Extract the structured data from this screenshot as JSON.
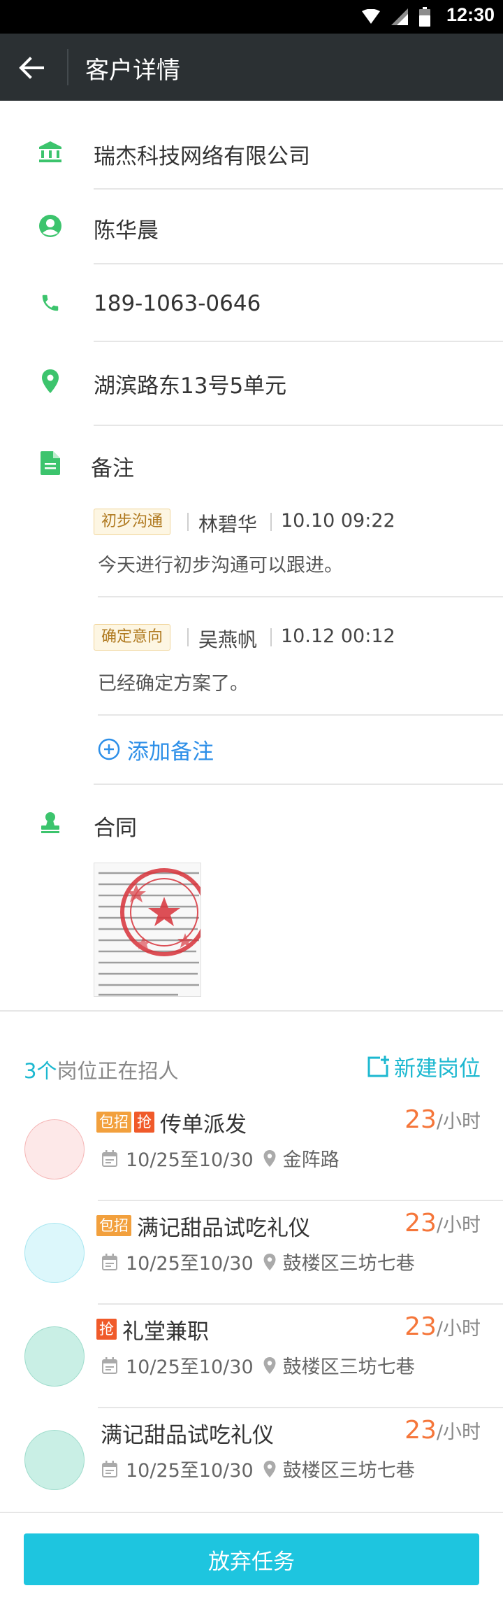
{
  "status_bar": {
    "time": "12:30"
  },
  "app_bar": {
    "title": "客户详情"
  },
  "customer": {
    "company": "瑞杰科技网络有限公司",
    "contact_name": "陈华晨",
    "phone": "189-1063-0646",
    "address": "湖滨路东13号5单元"
  },
  "notes": {
    "title": "备注",
    "items": [
      {
        "tag": "初步沟通",
        "author": "林碧华",
        "time": "10.10 09:22",
        "content": "今天进行初步沟通可以跟进。"
      },
      {
        "tag": "确定意向",
        "author": "吴燕帆",
        "time": "10.12 00:12",
        "content": "已经确定方案了。"
      }
    ],
    "add_label": "添加备注"
  },
  "contract": {
    "title": "合同"
  },
  "jobs": {
    "count": "3个",
    "header_label": "岗位正在招人",
    "new_label": "新建岗位",
    "unit": "/小时",
    "items": [
      {
        "badges": [
          "包招",
          "抢"
        ],
        "title": "传单派发",
        "date": "10/25至10/30",
        "location": "金阵路",
        "rate": "23",
        "avatar_color": "#fde8e8"
      },
      {
        "badges": [
          "包招"
        ],
        "title": "满记甜品试吃礼仪",
        "date": "10/25至10/30",
        "location": "鼓楼区三坊七巷",
        "rate": "23",
        "avatar_color": "#dcf7fb"
      },
      {
        "badges": [
          "抢"
        ],
        "title": "礼堂兼职",
        "date": "10/25至10/30",
        "location": "鼓楼区三坊七巷",
        "rate": "23",
        "avatar_color": "#c9efe5"
      },
      {
        "badges": [],
        "title": "满记甜品试吃礼仪",
        "date": "10/25至10/30",
        "location": "鼓楼区三坊七巷",
        "rate": "23",
        "avatar_color": "#c9efe5"
      }
    ]
  },
  "bottom_button": {
    "label": "放弃任务"
  },
  "colors": {
    "app_bar": "#2b3033",
    "icon_green": "#3cc46d",
    "accent_cyan": "#1cb8d0",
    "link_blue": "#2d8fe8",
    "rate_orange": "#f5763a"
  }
}
